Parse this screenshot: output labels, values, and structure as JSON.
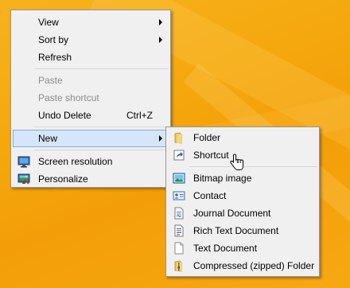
{
  "desktop": {
    "background_color": "#f5a80e"
  },
  "context_menu": {
    "items": [
      {
        "label": "View",
        "has_submenu": true
      },
      {
        "label": "Sort by",
        "has_submenu": true
      },
      {
        "label": "Refresh"
      },
      {
        "label": "Paste",
        "disabled": true
      },
      {
        "label": "Paste shortcut",
        "disabled": true
      },
      {
        "label": "Undo Delete",
        "shortcut": "Ctrl+Z"
      },
      {
        "label": "New",
        "has_submenu": true,
        "highlighted": true
      },
      {
        "label": "Screen resolution",
        "icon": "screen-resolution-icon"
      },
      {
        "label": "Personalize",
        "icon": "personalize-icon"
      }
    ]
  },
  "new_submenu": {
    "items": [
      {
        "label": "Folder",
        "icon": "folder-icon"
      },
      {
        "label": "Shortcut",
        "icon": "shortcut-icon"
      },
      {
        "label": "Bitmap image",
        "icon": "bitmap-image-icon"
      },
      {
        "label": "Contact",
        "icon": "contact-card-icon"
      },
      {
        "label": "Journal Document",
        "icon": "journal-document-icon"
      },
      {
        "label": "Rich Text Document",
        "icon": "rich-text-document-icon"
      },
      {
        "label": "Text Document",
        "icon": "text-document-icon"
      },
      {
        "label": "Compressed (zipped) Folder",
        "icon": "zipped-folder-icon"
      }
    ]
  },
  "colors": {
    "menu_background": "#f0f0f0",
    "menu_border": "#979797",
    "highlight_background": "#d5e6f8",
    "highlight_border": "#84aede",
    "disabled_text": "#8d8d8d"
  }
}
